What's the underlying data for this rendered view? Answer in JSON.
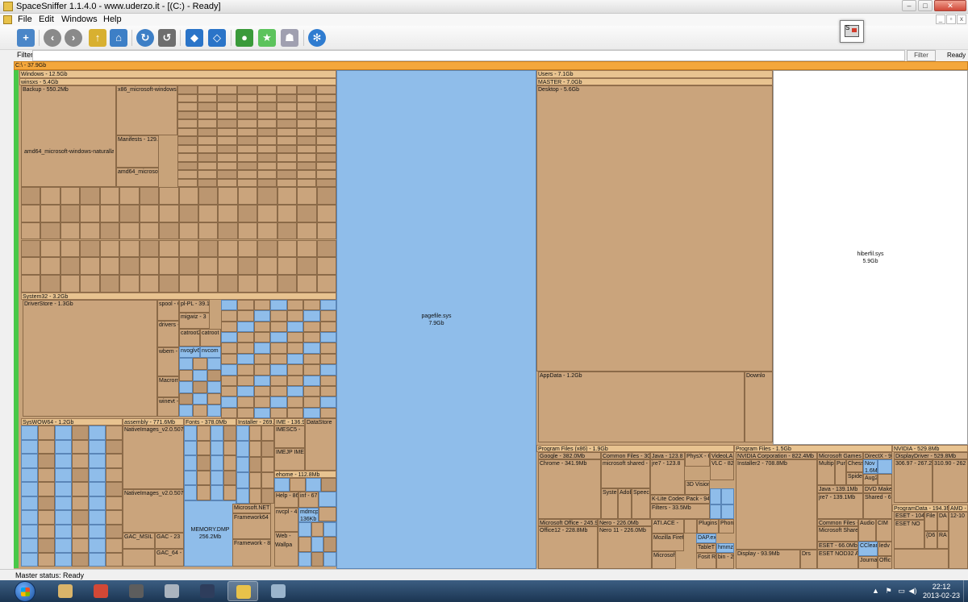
{
  "window": {
    "title": "SpaceSniffer 1.1.4.0 - www.uderzo.it - [(C:) - Ready]",
    "controls": {
      "minimize": "–",
      "maximize": "□",
      "close": "✕"
    }
  },
  "menu": {
    "items": [
      "File",
      "Edit",
      "Windows",
      "Help"
    ],
    "mdi_controls": {
      "minimize": "_",
      "restore": "▫",
      "close": "x"
    }
  },
  "toolbar": {
    "buttons": [
      {
        "name": "new-view-icon",
        "color": "#4a86c8"
      },
      {
        "name": "back-icon",
        "color": "#8a8a8a"
      },
      {
        "name": "forward-icon",
        "color": "#8a8a8a"
      },
      {
        "name": "up-folder-icon",
        "color": "#d8b030"
      },
      {
        "name": "home-icon",
        "color": "#3d7fc6"
      },
      {
        "name": "refresh-icon",
        "color": "#3d7fc6"
      },
      {
        "name": "refresh-all-icon",
        "color": "#6e6e6e"
      },
      {
        "name": "zoom-in-icon",
        "color": "#2a74c8"
      },
      {
        "name": "zoom-out-icon",
        "color": "#2a74c8"
      },
      {
        "name": "tags-icon",
        "color": "#3a9a3a"
      },
      {
        "name": "star-icon",
        "color": "#5cc35c"
      },
      {
        "name": "ghost-icon",
        "color": "#a0a0b0"
      },
      {
        "name": "settings-icon",
        "color": "#2f7cd0"
      }
    ],
    "corner_label": "S"
  },
  "filter": {
    "label": "Filter",
    "value": "",
    "placeholder": "",
    "button_label": "Filter",
    "status": "Ready"
  },
  "treemap": {
    "root": {
      "label": "C:\\ - 37.9Gb"
    },
    "windows": {
      "label": "Windows - 12.5Gb"
    },
    "winsxs": {
      "label": "winsxs - 5.4Gb"
    },
    "backup": {
      "label": "Backup - 550.2Mb"
    },
    "amd64_nat": {
      "label": "amd64_microsoft-windows-naturallang"
    },
    "x86_ms_win": {
      "label": "x86_microsoft-windows-n"
    },
    "manifests": {
      "label": "Manifests - 129.9"
    },
    "amd64_ms": {
      "label": "amd64_microsoft"
    },
    "system32": {
      "label": "System32 - 3.2Gb"
    },
    "driverstore": {
      "label": "DriverStore - 1.3Gb"
    },
    "spool": {
      "label": "spool - 62"
    },
    "drivers": {
      "label": "drivers -"
    },
    "wbem": {
      "label": "wbem -"
    },
    "macrome": {
      "label": "Macrome"
    },
    "winevt": {
      "label": "winevt -"
    },
    "plpl": {
      "label": "pl-PL - 39.1"
    },
    "migwiz": {
      "label": "migwiz - 3"
    },
    "catroot2": {
      "label": "catroot2"
    },
    "catroot": {
      "label": "catroot"
    },
    "nvcogl": {
      "label": "nvoglv6"
    },
    "nvcom": {
      "label": "nvcom"
    },
    "syswow": {
      "label": "SysWOW64 - 1.2Gb"
    },
    "assembly": {
      "label": "assembly - 771.6Mb"
    },
    "nativeimages1": {
      "label": "NativeImages_v2.0.507"
    },
    "nativeimages2": {
      "label": "NativeImages_v2.0.507"
    },
    "gac_msil": {
      "label": "GAC_MSIL -"
    },
    "gac23": {
      "label": "GAC - 23"
    },
    "gac64": {
      "label": "GAC_64 -"
    },
    "fonts": {
      "label": "Fonts - 378.0Mb"
    },
    "memdmp": {
      "label": "MEMORY.DMP",
      "size": "256.2Mb"
    },
    "installer": {
      "label": "Installer - 269."
    },
    "ime": {
      "label": "IME - 136.9"
    },
    "imesc": {
      "label": "IMESC5 -"
    },
    "imejp": {
      "label": "IMEJP IME"
    },
    "datastore": {
      "label": "DataStore"
    },
    "ehome": {
      "label": "ehome - 112.8Mb"
    },
    "msnet": {
      "label": "Microsoft.NET -"
    },
    "framework64": {
      "label": "Framework64 -"
    },
    "framework": {
      "label": "Framework - 8"
    },
    "help": {
      "label": "Help - 86."
    },
    "inf": {
      "label": "inf - 67"
    },
    "nvcpl": {
      "label": "nvcpl - 4"
    },
    "mdmcpq": {
      "label": "mdmcp",
      "size": "136Kb"
    },
    "web": {
      "label": "Web -"
    },
    "wallpa": {
      "label": "Wallpa"
    },
    "pagefile": {
      "label": "pagefile.sys",
      "size": "7.9Gb"
    },
    "users": {
      "label": "Users - 7.1Gb"
    },
    "master": {
      "label": "MASTER - 7.0Gb"
    },
    "desktop": {
      "label": "Desktop - 5.6Gb"
    },
    "appdata": {
      "label": "AppData - 1.2Gb"
    },
    "downloads": {
      "label": "Downlo"
    },
    "hiberfil": {
      "label": "hiberfil.sys",
      "size": "5.9Gb"
    },
    "pf86": {
      "label": "Program Files (x86) - 1.9Gb"
    },
    "google": {
      "label": "Google - 382.0Mb"
    },
    "chrome": {
      "label": "Chrome - 341.9Mb"
    },
    "common": {
      "label": "Common Files - 302"
    },
    "msshared": {
      "label": "microsoft shared - 1"
    },
    "java": {
      "label": "Java - 123.8"
    },
    "jre7": {
      "label": "jre7 - 123.8"
    },
    "physx": {
      "label": "PhysX - 6"
    },
    "videolan": {
      "label": "VideoLAN"
    },
    "vlc": {
      "label": "VLC - 82"
    },
    "d3dvision": {
      "label": "3D Vision"
    },
    "klite": {
      "label": "K-Lite Codec Pack - 94."
    },
    "filters": {
      "label": "Filters - 33.5Mb"
    },
    "syst": {
      "label": "Syste"
    },
    "adob": {
      "label": "Adob"
    },
    "speech": {
      "label": "Speech"
    },
    "atlace": {
      "label": "ATI.ACE -"
    },
    "plugins": {
      "label": "Plugins"
    },
    "phon": {
      "label": "Phon"
    },
    "msoffice": {
      "label": "Microsoft Office - 245.9"
    },
    "office12": {
      "label": "Office12 - 228.8Mb"
    },
    "nero": {
      "label": "Nero - 226.0Mb"
    },
    "nero11": {
      "label": "Nero 11 - 226.0Mb"
    },
    "mozilla": {
      "label": "Mozilla Firefo"
    },
    "microsoft2": {
      "label": "Microsoft"
    },
    "dapex": {
      "label": "DAP.ex"
    },
    "tablet": {
      "label": "TableT"
    },
    "fosit": {
      "label": "Fosit R"
    },
    "bin2": {
      "label": "bin - 2"
    },
    "hmmz": {
      "label": "hmmz"
    },
    "pf": {
      "label": "Program Files - 1.5Gb"
    },
    "nvcorp": {
      "label": "NVIDIA Corporation - 822.4Mb"
    },
    "installer2": {
      "label": "Installer2 - 708.8Mb"
    },
    "display": {
      "label": "Display - 93.9Mb"
    },
    "drs": {
      "label": "Drs"
    },
    "msgames": {
      "label": "Microsoft Games -"
    },
    "multip": {
      "label": "Multip"
    },
    "purl": {
      "label": "Purl"
    },
    "chess": {
      "label": "Chess"
    },
    "spide": {
      "label": "Spide"
    },
    "directx": {
      "label": "DirectX - 98."
    },
    "nov": {
      "label": "Nov",
      "size": "1.6M"
    },
    "aug2": {
      "label": "Aug2"
    },
    "java2": {
      "label": "Java - 139.1Mb"
    },
    "jre7b": {
      "label": "jre7 - 139.1Mb"
    },
    "dvdmaker": {
      "label": "DVD Maker"
    },
    "shared": {
      "label": "Shared - 6"
    },
    "commonfiles2": {
      "label": "Common Files -"
    },
    "msshared2": {
      "label": "Microsoft Shared"
    },
    "audio": {
      "label": "Audio"
    },
    "cim": {
      "label": "CIM"
    },
    "eset": {
      "label": "ESET - 66.0Mb"
    },
    "esetnod": {
      "label": "ESET NOD32 A"
    },
    "cclear": {
      "label": "CCleari"
    },
    "ledv": {
      "label": "ledv"
    },
    "journal": {
      "label": "Journal"
    },
    "offic": {
      "label": "Offic"
    },
    "nvidia": {
      "label": "NVIDIA - 529.8Mb"
    },
    "displaydriver": {
      "label": "DisplayDriver - 529.8Mb"
    },
    "dd1": {
      "label": "306.97 - 267.2"
    },
    "dd2": {
      "label": "310.90 - 262"
    },
    "progdata": {
      "label": "ProgramData - 194.3M"
    },
    "amd": {
      "label": "AMD -"
    },
    "eset2": {
      "label": "ESET - 104"
    },
    "esetno": {
      "label": "ESET NO"
    },
    "file": {
      "label": "File"
    },
    "da": {
      "label": "DA"
    },
    "d6": {
      "label": "{D6"
    },
    "ra": {
      "label": "RA"
    },
    "b12": {
      "label": "12-10"
    }
  },
  "status": {
    "text": "Master status: Ready"
  },
  "taskbar": {
    "apps": [
      {
        "name": "explorer-icon",
        "color": "#d9b46a"
      },
      {
        "name": "chrome-icon",
        "color": "#d34836"
      },
      {
        "name": "world-of-tanks-icon",
        "color": "#5d5d5d"
      },
      {
        "name": "vision-icon",
        "color": "#aab4bf"
      },
      {
        "name": "winamp-icon",
        "color": "#2e3d5c"
      },
      {
        "name": "spacesniffer-icon",
        "color": "#e8c24a"
      },
      {
        "name": "app-window-icon",
        "color": "#9ab4cc"
      }
    ],
    "tray": [
      "▲",
      "⚑",
      "▭",
      "◀)"
    ],
    "time": "22:12",
    "date": "2013-02-23"
  }
}
